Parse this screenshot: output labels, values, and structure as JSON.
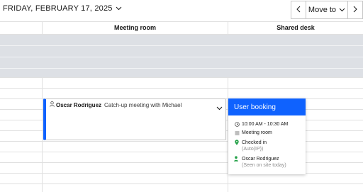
{
  "header": {
    "date_label": "FRIDAY, FEBRUARY 17, 2025",
    "move_to_label": "Move to"
  },
  "columns": {
    "meeting_room": "Meeting room",
    "shared_desk": "Shared desk"
  },
  "booking": {
    "person": "Oscar Rodriguez",
    "title": "Catch-up meeting with Michael"
  },
  "popover": {
    "header": "User booking",
    "time": "10:00 AM - 10:30 AM",
    "resource": "Meeting room",
    "status": "Checked in",
    "status_detail": "(Auto(IP))",
    "user": "Oscar Rodriguez",
    "user_detail": "(Seen on site today)"
  },
  "colors": {
    "accent": "#0f62fe",
    "checked_in": "#24a148",
    "unavailable_shade": "#dde0e5"
  },
  "icons": {
    "date_chevron": "chevron-down-icon",
    "prev": "chevron-left-icon",
    "next": "chevron-right-icon",
    "move_to": "chevron-down-icon",
    "person": "user-icon",
    "expand": "chevron-down-icon",
    "time": "clock-icon",
    "resource": "list-icon",
    "status": "location-pin-icon",
    "user": "user-check-icon"
  }
}
